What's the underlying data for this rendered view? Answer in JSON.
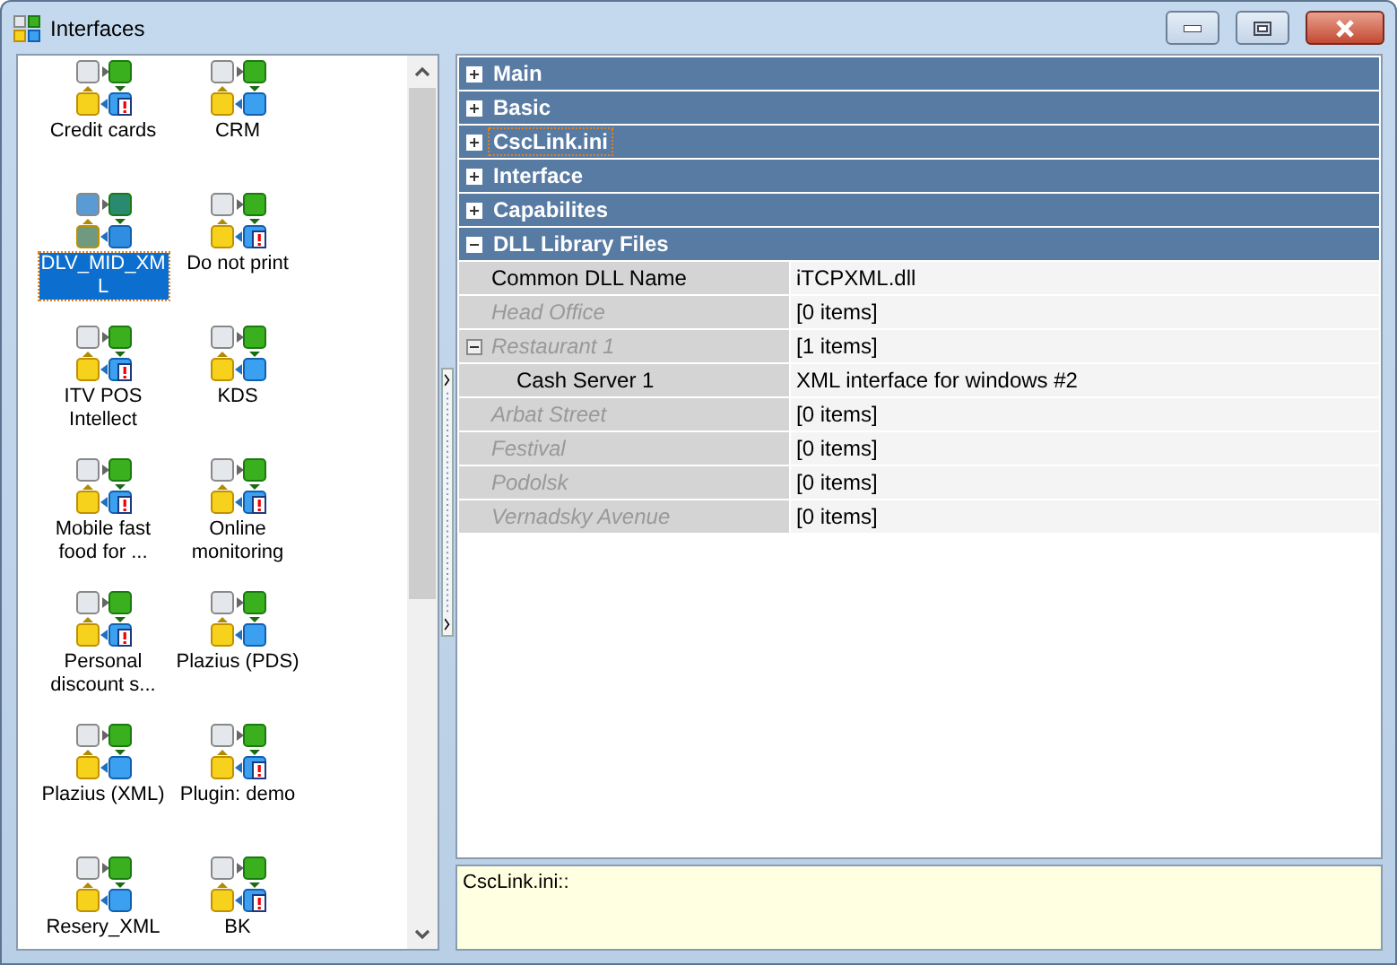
{
  "window": {
    "title": "Interfaces"
  },
  "interfaces": [
    {
      "label": "Credit cards",
      "flagged": true,
      "selected": false
    },
    {
      "label": "CRM",
      "flagged": false,
      "selected": false
    },
    {
      "label": "DLV_MID_XML",
      "flagged": false,
      "selected": true
    },
    {
      "label": "Do not print",
      "flagged": true,
      "selected": false
    },
    {
      "label": "ITV POS Intellect",
      "flagged": true,
      "selected": false
    },
    {
      "label": "KDS",
      "flagged": false,
      "selected": false
    },
    {
      "label": "Mobile fast food for ...",
      "flagged": true,
      "selected": false
    },
    {
      "label": "Online monitoring",
      "flagged": true,
      "selected": false
    },
    {
      "label": "Personal discount s...",
      "flagged": true,
      "selected": false
    },
    {
      "label": "Plazius (PDS)",
      "flagged": false,
      "selected": false
    },
    {
      "label": "Plazius (XML)",
      "flagged": false,
      "selected": false
    },
    {
      "label": "Plugin: demo",
      "flagged": true,
      "selected": false
    },
    {
      "label": "Resery_XML",
      "flagged": false,
      "selected": false
    },
    {
      "label": "BK",
      "flagged": true,
      "selected": false
    }
  ],
  "categories": [
    {
      "label": "Main",
      "expanded": false,
      "selected": false
    },
    {
      "label": "Basic",
      "expanded": false,
      "selected": false
    },
    {
      "label": "CscLink.ini",
      "expanded": false,
      "selected": true
    },
    {
      "label": "Interface",
      "expanded": false,
      "selected": false
    },
    {
      "label": "Capabilites",
      "expanded": false,
      "selected": false
    },
    {
      "label": "DLL Library Files",
      "expanded": true,
      "selected": false,
      "properties": [
        {
          "name": "Common DLL Name",
          "value": "iTCPXML.dll",
          "disabled": false
        },
        {
          "name": "Head Office",
          "value": "[0 items]",
          "disabled": true
        },
        {
          "name": "Restaurant 1",
          "value": "[1 items]",
          "disabled": true,
          "expanded": true,
          "children": [
            {
              "name": "Cash Server 1",
              "value": "XML interface for windows #2",
              "disabled": false
            }
          ]
        },
        {
          "name": "Arbat Street",
          "value": "[0 items]",
          "disabled": true
        },
        {
          "name": "Festival",
          "value": "[0 items]",
          "disabled": true
        },
        {
          "name": "Podolsk",
          "value": "[0 items]",
          "disabled": true
        },
        {
          "name": "Vernadsky Avenue",
          "value": "[0 items]",
          "disabled": true
        }
      ]
    }
  ],
  "description": {
    "text": "CscLink.ini::"
  }
}
